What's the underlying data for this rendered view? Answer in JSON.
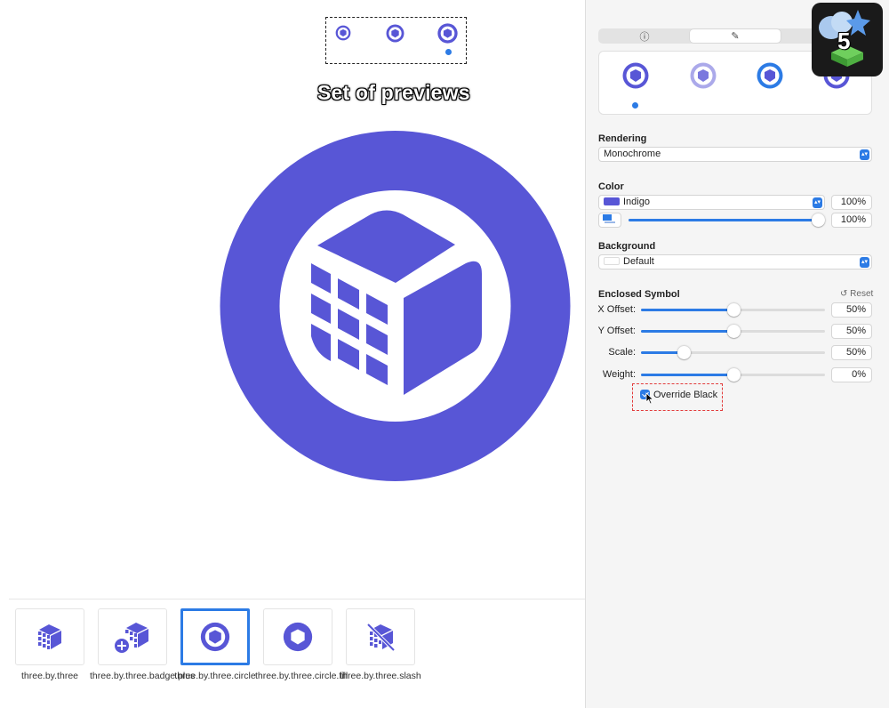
{
  "annotation": {
    "preview_caption": "Set of previews"
  },
  "gallery": {
    "items": [
      {
        "label": "three.by.three",
        "selected": false
      },
      {
        "label": "three.by.three.badge.plus",
        "selected": false
      },
      {
        "label": "three.by.three.circle",
        "selected": true
      },
      {
        "label": "three.by.three.circle.fill",
        "selected": false
      },
      {
        "label": "three.by.three.slash",
        "selected": false
      }
    ]
  },
  "inspector": {
    "tabs": [
      {
        "icon": "info-icon",
        "label": "ⓘ",
        "active": false
      },
      {
        "icon": "paintbrush-icon",
        "label": "✎",
        "active": true
      }
    ],
    "rendering": {
      "label": "Rendering",
      "value": "Monochrome"
    },
    "color": {
      "label": "Color",
      "value": "Indigo",
      "percent": "100%",
      "opacity_percent": "100%",
      "opacity_fill": 1.0
    },
    "background": {
      "label": "Background",
      "value": "Default"
    },
    "enclosed_symbol": {
      "label": "Enclosed Symbol",
      "reset_label": "Reset",
      "rows": [
        {
          "label": "X Offset:",
          "value": "50%",
          "fill": 0.5
        },
        {
          "label": "Y Offset:",
          "value": "50%",
          "fill": 0.5
        },
        {
          "label": "Scale:",
          "value": "50%",
          "fill": 0.23
        },
        {
          "label": "Weight:",
          "value": "0%",
          "fill": 0.5
        }
      ],
      "override_black_label": "Override Black",
      "override_black_checked": true
    }
  },
  "badge": {
    "number": "5"
  },
  "colors": {
    "indigo": "#5856d6",
    "accent": "#2c7be5",
    "annotation_red": "#e23b3b"
  }
}
